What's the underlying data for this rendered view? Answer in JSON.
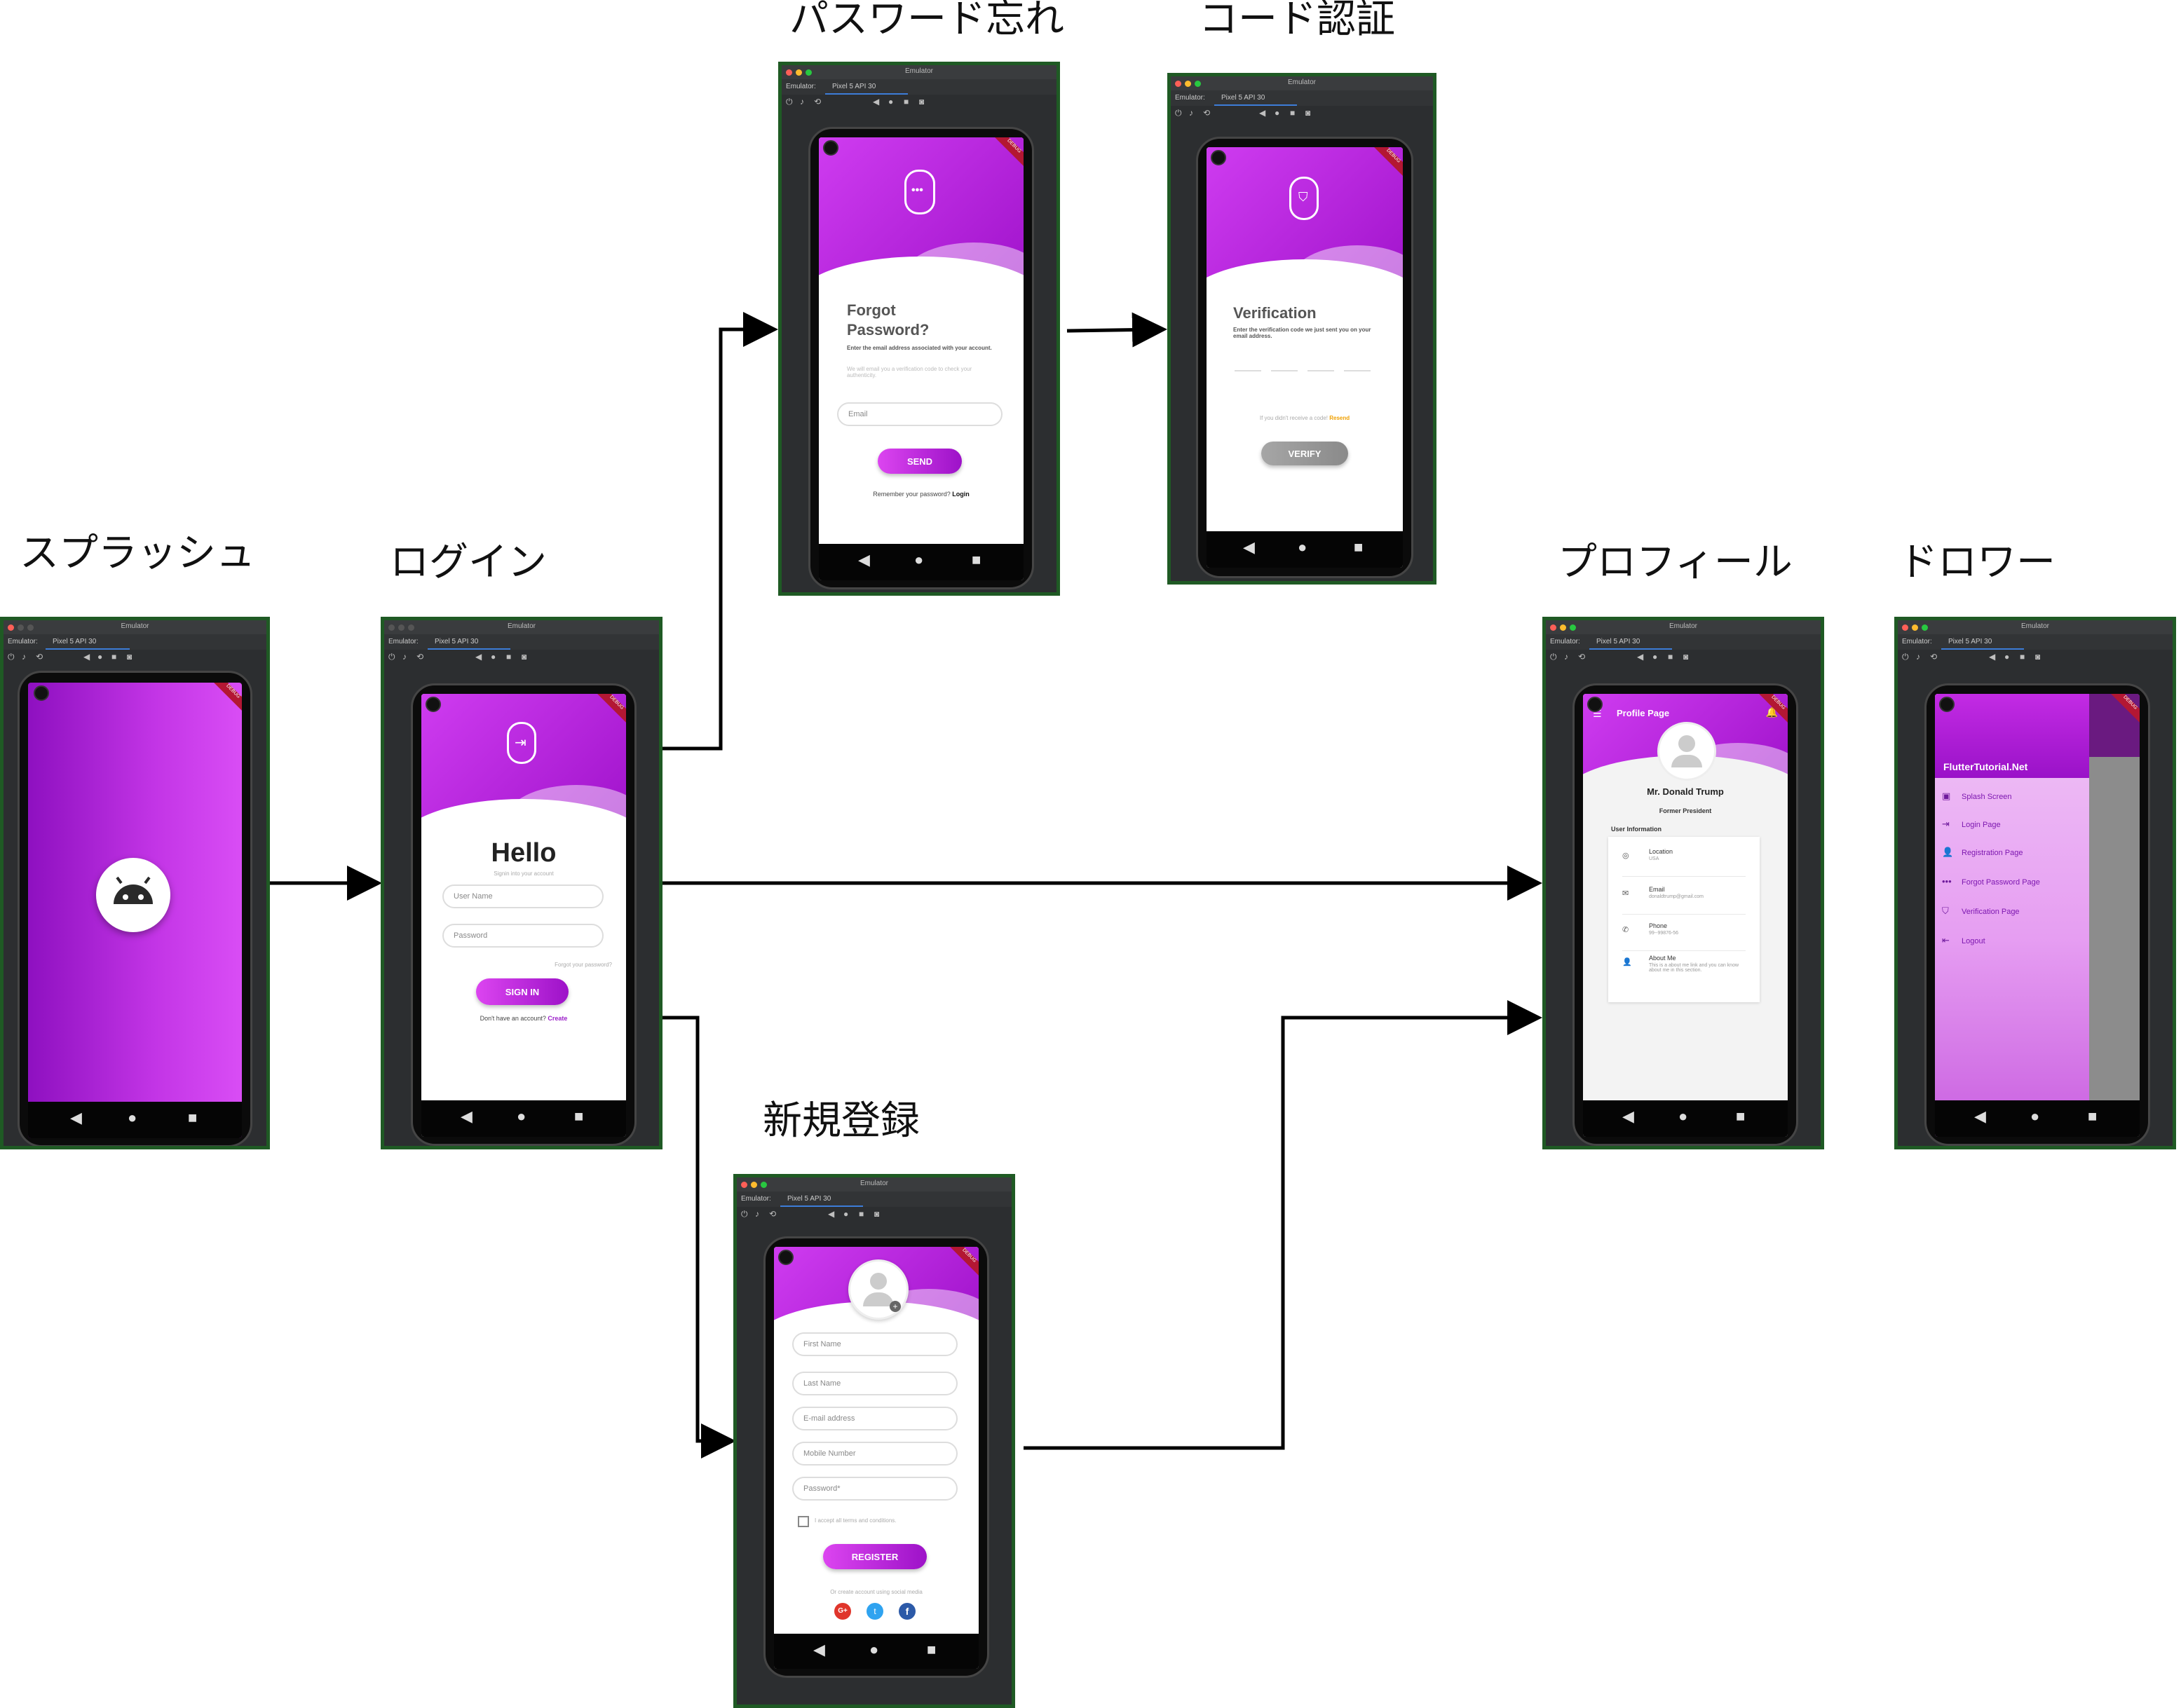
{
  "labels": {
    "splash": "スプラッシュ",
    "login": "ログイン",
    "forgot": "パスワード忘れ",
    "verify": "コード認証",
    "register": "新規登録",
    "profile": "プロフィール",
    "drawer": "ドロワー"
  },
  "emulator": {
    "window_title": "Emulator",
    "tab_prefix": "Emulator:",
    "device_tab": "Pixel 5 API 30",
    "debug_badge": "DEBUG"
  },
  "login_screen": {
    "title": "Hello",
    "subtitle": "Signin into your account",
    "username_placeholder": "User Name",
    "password_placeholder": "Password",
    "forgot_link": "Forgot your password?",
    "signin_button": "SIGN IN",
    "no_account": "Don't have an account?",
    "create_link": "Create"
  },
  "forgot_screen": {
    "title_line1": "Forgot",
    "title_line2": "Password?",
    "desc": "Enter the email address associated with your account.",
    "note": "We will email you a verification code to check your authenticity.",
    "email_placeholder": "Email",
    "send_button": "SEND",
    "remember": "Remember your password?",
    "login_link": "Login"
  },
  "verify_screen": {
    "title": "Verification",
    "desc": "Enter the verification code we just sent you on your email address.",
    "resend_prompt": "If you didn't receive a code!",
    "resend_link": "Resend",
    "verify_button": "VERIFY"
  },
  "register_screen": {
    "first_name": "First Name",
    "last_name": "Last Name",
    "email": "E-mail address",
    "mobile": "Mobile Number",
    "password": "Password*",
    "terms": "I accept all terms and conditions.",
    "register_button": "REGISTER",
    "social_note": "Or create account using social media"
  },
  "profile_screen": {
    "appbar_title": "Profile Page",
    "name": "Mr. Donald Trump",
    "role": "Former President",
    "section": "User Information",
    "rows": [
      {
        "label": "Location",
        "value": "USA"
      },
      {
        "label": "Email",
        "value": "donaldtrump@gmail.com"
      },
      {
        "label": "Phone",
        "value": "99--99876-56"
      },
      {
        "label": "About Me",
        "value": "This is a about me link and you can know about me in this section."
      }
    ]
  },
  "drawer_screen": {
    "header": "FlutterTutorial.Net",
    "items": [
      {
        "label": "Splash Screen",
        "icon": "screen-icon"
      },
      {
        "label": "Login Page",
        "icon": "login-icon"
      },
      {
        "label": "Registration Page",
        "icon": "person-add-icon"
      },
      {
        "label": "Forgot Password Page",
        "icon": "password-icon"
      },
      {
        "label": "Verification Page",
        "icon": "shield-icon"
      },
      {
        "label": "Logout",
        "icon": "logout-icon"
      }
    ]
  },
  "colors": {
    "brand_purple": "#b01ee0",
    "brand_dark": "#8a10b8",
    "frame_border": "#1f5a24",
    "arrow": "#000000",
    "resend": "#f0a000"
  }
}
